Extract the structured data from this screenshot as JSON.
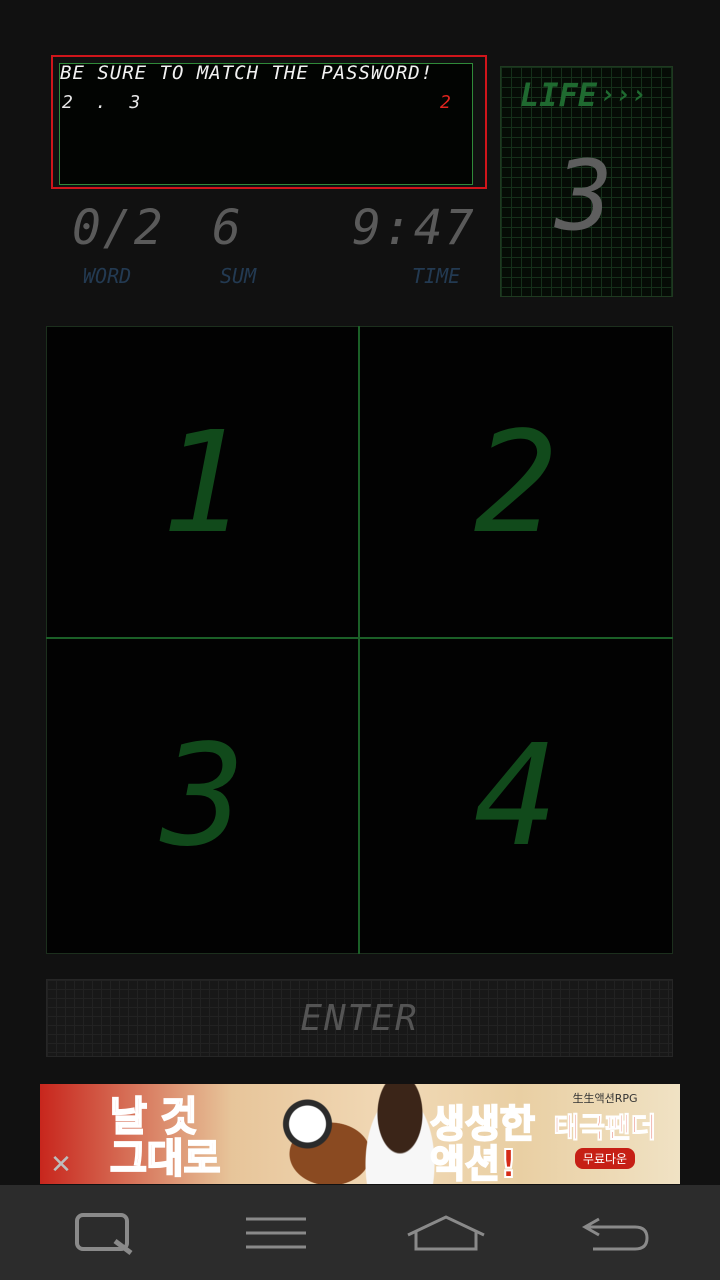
{
  "message": {
    "instruction": "BE SURE TO MATCH THE PASSWORD!",
    "sequence": "2 . 3",
    "count": "2"
  },
  "stats": {
    "word_value": "0/2",
    "word_label": "WORD",
    "sum_value": "6",
    "sum_label": "SUM",
    "time_value": "9:47",
    "time_label": "TIME"
  },
  "life": {
    "label": "LIFE",
    "arrows": "›››",
    "value": "3"
  },
  "keypad": {
    "keys": [
      "1",
      "2",
      "3",
      "4"
    ]
  },
  "enter_label": "ENTER",
  "ad": {
    "line1": "날 것",
    "line2": "그대로",
    "line3": "생생한",
    "line4": "액션!",
    "logo_top": "生生액션RPG",
    "logo_main": "태극팬더",
    "logo_cta": "무료다운",
    "close": "✕"
  },
  "colors": {
    "accent_green": "#1b5f27",
    "alert_red": "#d0151b",
    "nav_bg": "#2c2c2c"
  },
  "navbar": {
    "icons": [
      "search-icon",
      "menu-icon",
      "home-icon",
      "back-icon"
    ]
  }
}
